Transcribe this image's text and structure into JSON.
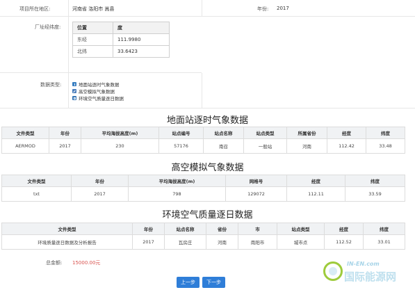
{
  "project": {
    "region_label": "项目所在地区:",
    "region_value": "河南省 洛阳市 嵩县",
    "year_label": "年份:",
    "year_value": "2017"
  },
  "coordinates": {
    "label": "厂址经纬度:",
    "header": [
      "位置",
      "度"
    ],
    "rows": [
      {
        "name": "东经",
        "value": "111.9980"
      },
      {
        "name": "北纬",
        "value": "33.6423"
      }
    ]
  },
  "data_types": {
    "label": "数据类型:",
    "items": [
      {
        "icon": "info-icon",
        "text": "地面站逐时气象数据"
      },
      {
        "icon": "pen-icon",
        "text": "高空模拟气象数据"
      },
      {
        "icon": "document-icon",
        "text": "环境空气质量逐日数据"
      }
    ]
  },
  "ground": {
    "title": "地面站逐时气象数据",
    "headers": [
      "文件类型",
      "年份",
      "平均海拔高度(m)",
      "站点编号",
      "站点名称",
      "站点类型",
      "所属省份",
      "经度",
      "纬度"
    ],
    "row": [
      "AERMOD",
      "2017",
      "230",
      "57176",
      "南召",
      "一般站",
      "河南",
      "112.42",
      "33.48"
    ]
  },
  "upper": {
    "title": "高空模拟气象数据",
    "headers": [
      "文件类型",
      "年份",
      "平均海拔高度(m)",
      "网格号",
      "经度",
      "纬度"
    ],
    "row": [
      "txt",
      "2017",
      "798",
      "129072",
      "112.11",
      "33.59"
    ]
  },
  "air": {
    "title": "环境空气质量逐日数据",
    "headers": [
      "文件类型",
      "年份",
      "站点名称",
      "省份",
      "市",
      "站点类型",
      "经度",
      "纬度"
    ],
    "row": [
      "环境质量逐日数据及分析报告",
      "2017",
      "瓦房庄",
      "河南",
      "南阳市",
      "城市点",
      "112.52",
      "33.01"
    ]
  },
  "total": {
    "label": "总金额:",
    "value": "15000.00元"
  },
  "buttons": {
    "prev": "上一步",
    "next": "下一步"
  },
  "watermark": {
    "top": "IN-EN.com",
    "main": "国际能源网"
  },
  "colors": {
    "button": "#2f7ed8",
    "amount": "#d9534f",
    "header_bg": "#f0f2f4"
  }
}
